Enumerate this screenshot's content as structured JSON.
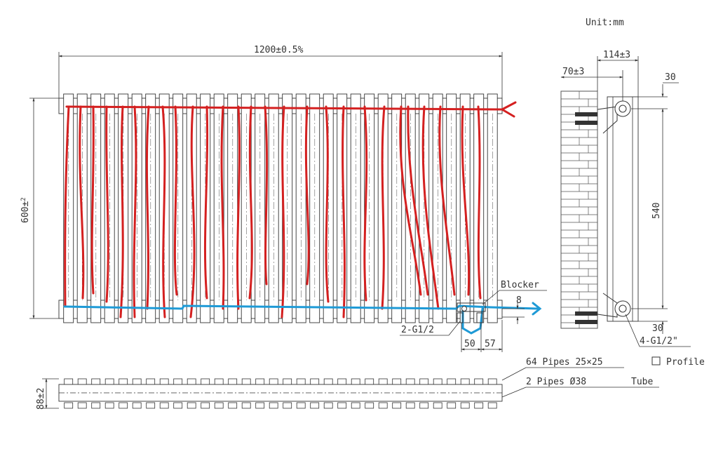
{
  "unit_label": "Unit:mm",
  "front_view": {
    "width_dim": "1200±0.5%",
    "height_dim": "600±",
    "height_dim_tolerance": "2",
    "pipe_count_drawn": 32,
    "blocker_label": "Blocker",
    "inlet_label": "2-G1/2",
    "dim_8": "8",
    "dim_50": "50",
    "dim_57": "57"
  },
  "side_view": {
    "depth_dim": "114±3",
    "wall_dim": "70±3",
    "top_offset": "30",
    "center_dim": "540",
    "bottom_offset": "30",
    "connection_label": "4-G1/2\""
  },
  "top_view": {
    "depth_dim": "88±2",
    "pipes_label": "64 Pipes 25×25",
    "profile_label": "Profile",
    "tubes_label": "2 Pipes Ø38",
    "tube_label": "Tube"
  },
  "colors": {
    "hot_flow": "#d42020",
    "cold_flow": "#1e9ad6",
    "line": "#333333",
    "wall_bricks": "#555555"
  }
}
